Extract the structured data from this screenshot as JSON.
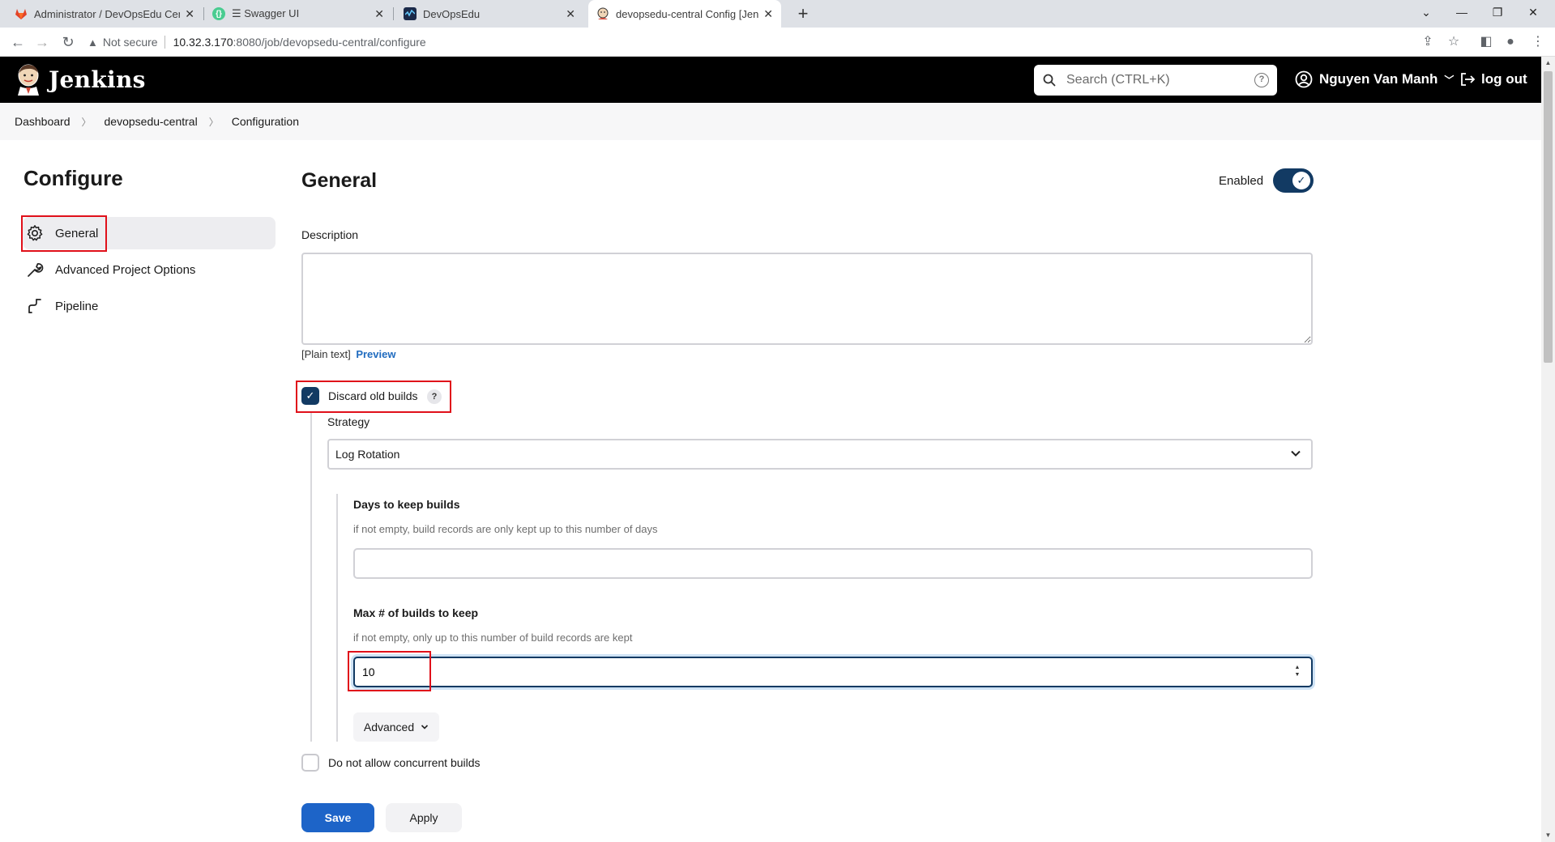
{
  "browser": {
    "tabs": [
      {
        "title": "Administrator / DevOpsEdu Cent",
        "icon": "gitlab-icon",
        "color": "#e24329"
      },
      {
        "title": "☰ Swagger UI",
        "icon": "swagger-icon",
        "color": "#49cc90"
      },
      {
        "title": "DevOpsEdu",
        "icon": "app-icon",
        "color": "#1b2a4a"
      },
      {
        "title": "devopsedu-central Config [Jenkir",
        "icon": "jenkins-icon",
        "color": "#d24939",
        "active": true
      }
    ],
    "address": {
      "security_label": "Not secure",
      "host": "10.32.3.170",
      "path": ":8080/job/devopsedu-central/configure"
    }
  },
  "header": {
    "title": "Jenkins",
    "search_placeholder": "Search (CTRL+K)",
    "user": "Nguyen Van Manh",
    "logout": "log out"
  },
  "breadcrumb": [
    "Dashboard",
    "devopsedu-central",
    "Configuration"
  ],
  "sidebar": {
    "title": "Configure",
    "items": [
      {
        "label": "General",
        "icon": "gear-icon",
        "active": true
      },
      {
        "label": "Advanced Project Options",
        "icon": "wrench-icon"
      },
      {
        "label": "Pipeline",
        "icon": "pipeline-icon"
      }
    ]
  },
  "main": {
    "title": "General",
    "enabled_label": "Enabled",
    "enabled": true,
    "description_label": "Description",
    "description_value": "",
    "plain_text": "[Plain text]",
    "preview": "Preview",
    "discard_label": "Discard old builds",
    "discard_checked": true,
    "help_glyph": "?",
    "strategy_label": "Strategy",
    "strategy_value": "Log Rotation",
    "days_label": "Days to keep builds",
    "days_hint": "if not empty, build records are only kept up to this number of days",
    "days_value": "",
    "max_label": "Max # of builds to keep",
    "max_hint": "if not empty, only up to this number of build records are kept",
    "max_value": "10",
    "advanced_label": "Advanced",
    "concurrent_label": "Do not allow concurrent builds",
    "concurrent_checked": false
  },
  "actions": {
    "save": "Save",
    "apply": "Apply"
  }
}
